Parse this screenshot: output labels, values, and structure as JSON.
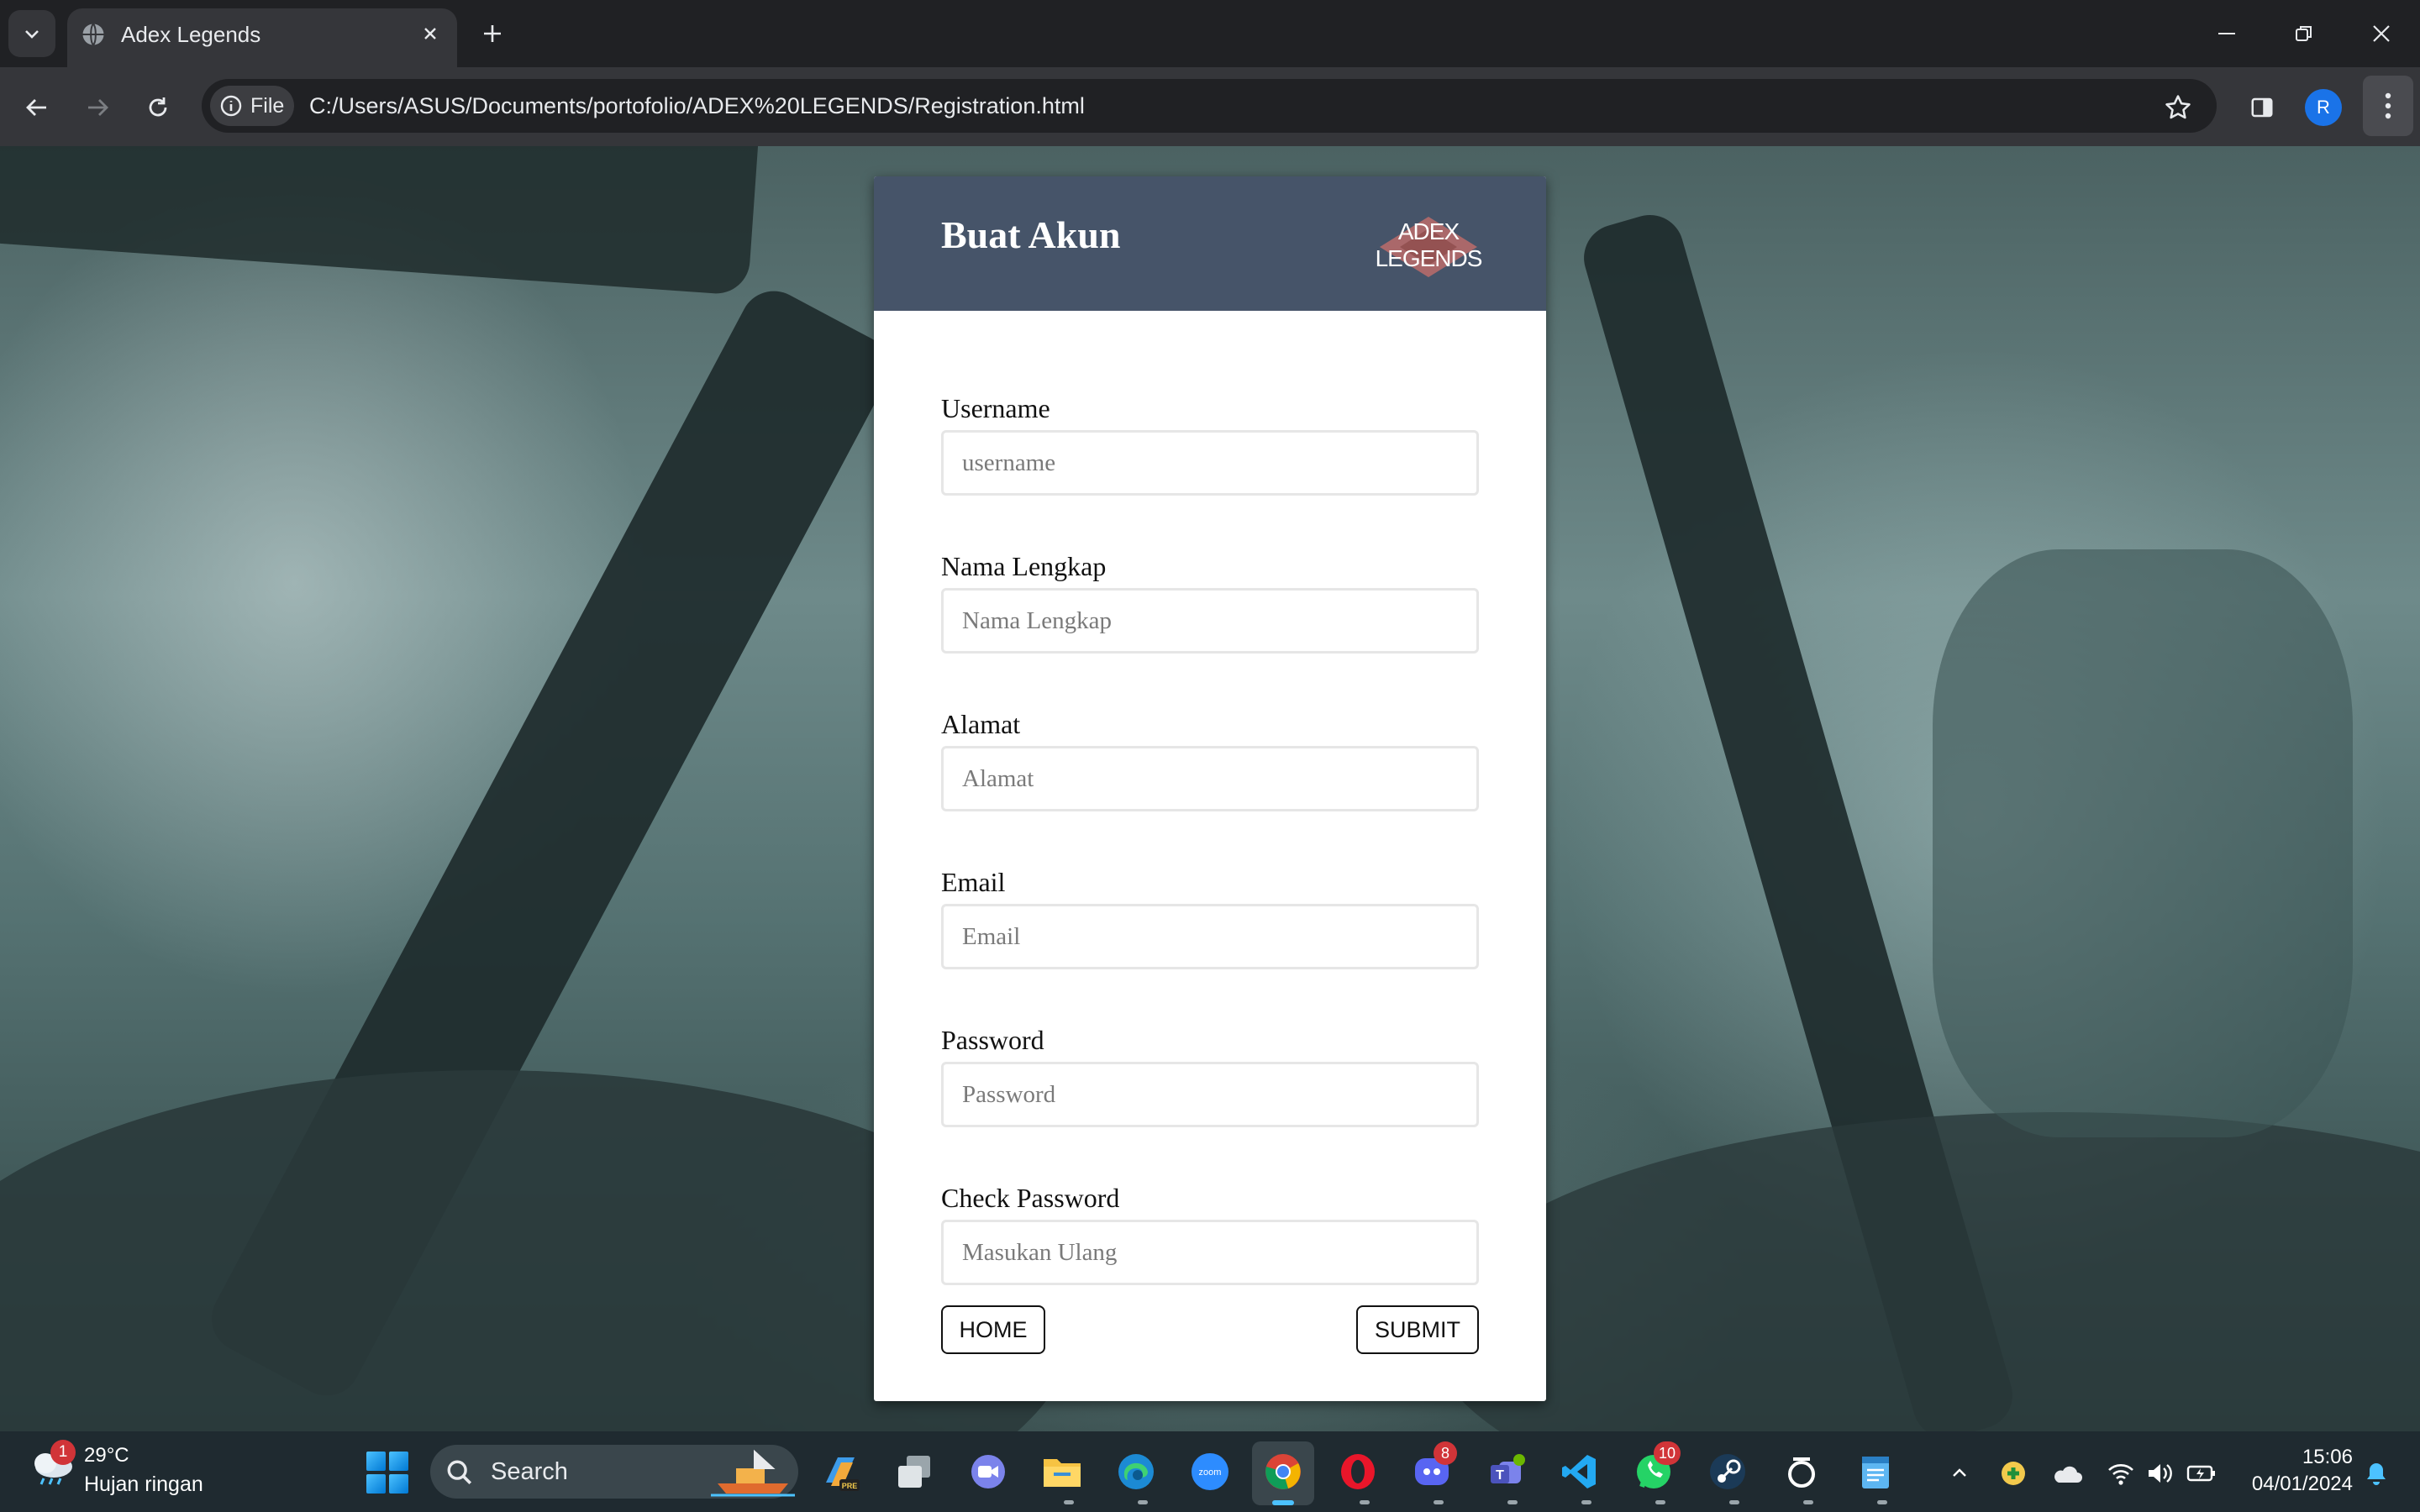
{
  "browser": {
    "tab_title": "Adex Legends",
    "site_chip_label": "File",
    "url": "C:/Users/ASUS/Documents/portofolio/ADEX%20LEGENDS/Registration.html",
    "profile_initial": "R"
  },
  "page": {
    "title": "Buat Akun",
    "logo_line1": "ADEX",
    "logo_line2": "LEGENDS",
    "fields": [
      {
        "label": "Username",
        "placeholder": "username",
        "value": ""
      },
      {
        "label": "Nama Lengkap",
        "placeholder": "Nama Lengkap",
        "value": ""
      },
      {
        "label": "Alamat",
        "placeholder": "Alamat",
        "value": ""
      },
      {
        "label": "Email",
        "placeholder": "Email",
        "value": ""
      },
      {
        "label": "Password",
        "placeholder": "Password",
        "value": ""
      },
      {
        "label": "Check Password",
        "placeholder": "Masukan Ulang",
        "value": ""
      }
    ],
    "home_button": "HOME",
    "submit_button": "SUBMIT"
  },
  "taskbar": {
    "weather_badge": "1",
    "weather_temp": "29°C",
    "weather_desc": "Hujan ringan",
    "search_label": "Search",
    "discord_badge": "8",
    "whatsapp_badge": "10",
    "time": "15:06",
    "date": "04/01/2024",
    "apps": [
      "copilot-pre",
      "task-view",
      "teams-meet",
      "file-explorer",
      "edge",
      "zoom",
      "chrome",
      "opera",
      "discord",
      "teams",
      "vscode",
      "whatsapp",
      "steam",
      "ring-app",
      "notepad"
    ]
  },
  "colors": {
    "card_header": "#465469",
    "chrome_bg": "#202124",
    "toolbar_bg": "#35363a",
    "taskbar_bg": "#1f2a30",
    "accent": "#4cc2ff"
  }
}
